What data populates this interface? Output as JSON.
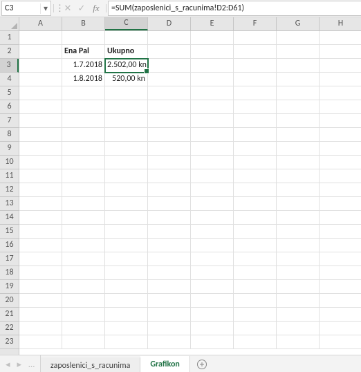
{
  "formula_bar": {
    "namebox": "C3",
    "formula": "=SUM(zaposlenici_s_racunima!D2:D61)"
  },
  "columns": [
    "A",
    "B",
    "C",
    "D",
    "E",
    "F",
    "G",
    "H"
  ],
  "rows": [
    "1",
    "2",
    "3",
    "4",
    "5",
    "6",
    "7",
    "8",
    "9",
    "10",
    "11",
    "12",
    "13",
    "14",
    "15",
    "16",
    "17",
    "18",
    "19",
    "20",
    "21",
    "22",
    "23"
  ],
  "selected": {
    "col": "C",
    "row": "3",
    "col_index": 2,
    "row_index": 2
  },
  "cells": {
    "B2": "Ena Pal",
    "C2": "Ukupno",
    "B3": "1.7.2018",
    "C3": "2.502,00 kn",
    "B4": "1.8.2018",
    "C4": "520,00 kn"
  },
  "tabs": {
    "items": [
      "zaposlenici_s_racunima",
      "Grafikon"
    ],
    "active": 1
  },
  "icons": {
    "dropdown": "▾",
    "vdots": "⋮",
    "cancel": "✕",
    "enter": "✓",
    "fx": "fx",
    "nav_prev": "◂",
    "nav_next": "▸",
    "nav_dots": "…"
  }
}
